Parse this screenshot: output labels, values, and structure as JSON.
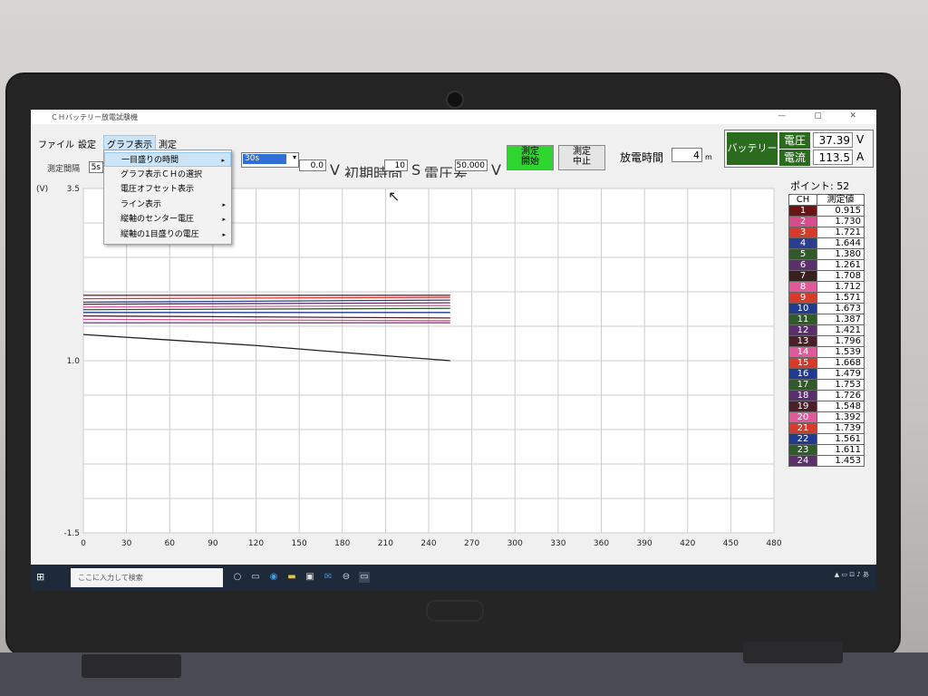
{
  "titlebar": {
    "title": "ＣＨバッテリー放電試験機",
    "controls": "— ▢ ✕"
  },
  "menu": {
    "file": "ファイル",
    "settings": "設定",
    "graph": "グラフ表示",
    "measure": "測定"
  },
  "dropdown": {
    "items": [
      {
        "label": "一目盛りの時間",
        "submenu": true
      },
      {
        "label": "グラフ表示ＣＨの選択",
        "submenu": false
      },
      {
        "label": "電圧オフセット表示",
        "submenu": false
      },
      {
        "label": "ライン表示",
        "submenu": true
      },
      {
        "label": "縦軸のセンター電圧",
        "submenu": true
      },
      {
        "label": "縦軸の1目盛りの電圧",
        "submenu": true
      }
    ],
    "arrow": "▸"
  },
  "combo": {
    "value": "30s",
    "arrow": "▾"
  },
  "toolbar": {
    "interval_label": "測定間隔",
    "interval_value": "5s",
    "voltage_value": "0.0",
    "voltage_unit": "V",
    "init_time_label": "初期時間",
    "init_time_value": "10",
    "init_time_unit": "S",
    "voltage_diff_label": "電圧差",
    "voltage_diff_value": "50.000",
    "voltage_diff_unit": "V",
    "start_button": "測定\n開始",
    "stop_button": "測定\n中止",
    "discharge_label": "放電時間",
    "discharge_value": "4",
    "discharge_unit": "m"
  },
  "battery": {
    "button": "バッテリー",
    "voltage_label": "電圧",
    "voltage_value": "37.39",
    "voltage_unit": "V",
    "current_label": "電流",
    "current_value": "113.5",
    "current_unit": "A"
  },
  "points": {
    "label": "ポイント: 52"
  },
  "table": {
    "headers": [
      "CH",
      "測定値"
    ],
    "rows": [
      {
        "ch": "1",
        "value": "0.915",
        "color": "#6b1414"
      },
      {
        "ch": "2",
        "value": "1.730",
        "color": "#d64d8c"
      },
      {
        "ch": "3",
        "value": "1.721",
        "color": "#d63a2a"
      },
      {
        "ch": "4",
        "value": "1.644",
        "color": "#2a3d8f"
      },
      {
        "ch": "5",
        "value": "1.380",
        "color": "#2f5a2a"
      },
      {
        "ch": "6",
        "value": "1.261",
        "color": "#5a2f6b"
      },
      {
        "ch": "7",
        "value": "1.708",
        "color": "#3a1f1f"
      },
      {
        "ch": "8",
        "value": "1.712",
        "color": "#e05a9a"
      },
      {
        "ch": "9",
        "value": "1.571",
        "color": "#d63a2a"
      },
      {
        "ch": "10",
        "value": "1.673",
        "color": "#1f3a8f"
      },
      {
        "ch": "11",
        "value": "1.387",
        "color": "#2f5a2a"
      },
      {
        "ch": "12",
        "value": "1.421",
        "color": "#5a2f6b"
      },
      {
        "ch": "13",
        "value": "1.796",
        "color": "#4a1f2a"
      },
      {
        "ch": "14",
        "value": "1.539",
        "color": "#e05a9a"
      },
      {
        "ch": "15",
        "value": "1.668",
        "color": "#d63a2a"
      },
      {
        "ch": "16",
        "value": "1.479",
        "color": "#1f3a8f"
      },
      {
        "ch": "17",
        "value": "1.753",
        "color": "#2f5a2a"
      },
      {
        "ch": "18",
        "value": "1.726",
        "color": "#5a2f6b"
      },
      {
        "ch": "19",
        "value": "1.548",
        "color": "#4a1f2a"
      },
      {
        "ch": "20",
        "value": "1.392",
        "color": "#e05a9a"
      },
      {
        "ch": "21",
        "value": "1.739",
        "color": "#d63a2a"
      },
      {
        "ch": "22",
        "value": "1.561",
        "color": "#1f3a8f"
      },
      {
        "ch": "23",
        "value": "1.611",
        "color": "#2f5a2a"
      },
      {
        "ch": "24",
        "value": "1.453",
        "color": "#5a2f6b"
      }
    ]
  },
  "chart_data": {
    "type": "line",
    "ylabel": "(V)",
    "y_ticks": [
      "3.5",
      "1.0",
      "-1.5"
    ],
    "ylim": [
      -1.5,
      3.5
    ],
    "x_ticks": [
      "0",
      "30",
      "60",
      "90",
      "120",
      "150",
      "180",
      "210",
      "240",
      "270",
      "300",
      "330",
      "360",
      "390",
      "420",
      "450",
      "480"
    ],
    "xlim": [
      0,
      480
    ],
    "x_tick_step": 30,
    "grid": true,
    "series": [
      {
        "values_x": [
          0,
          255
        ],
        "values_y": [
          1.95,
          1.95
        ],
        "color": "#8a1f3a"
      },
      {
        "values_x": [
          0,
          255
        ],
        "values_y": [
          1.9,
          1.92
        ],
        "color": "#d63a2a"
      },
      {
        "values_x": [
          0,
          255
        ],
        "values_y": [
          1.85,
          1.88
        ],
        "color": "#2a3d8f"
      },
      {
        "values_x": [
          0,
          255
        ],
        "values_y": [
          1.82,
          1.84
        ],
        "color": "#5a2f6b"
      },
      {
        "values_x": [
          0,
          255
        ],
        "values_y": [
          1.78,
          1.8
        ],
        "color": "#e05a9a"
      },
      {
        "values_x": [
          0,
          255
        ],
        "values_y": [
          1.74,
          1.76
        ],
        "color": "#2f5a2a"
      },
      {
        "values_x": [
          0,
          255
        ],
        "values_y": [
          1.7,
          1.7
        ],
        "color": "#1f3a8f"
      },
      {
        "values_x": [
          0,
          255
        ],
        "values_y": [
          1.65,
          1.62
        ],
        "color": "#4a1f2a"
      },
      {
        "values_x": [
          0,
          255
        ],
        "values_y": [
          1.6,
          1.58
        ],
        "color": "#d64d8c"
      },
      {
        "values_x": [
          0,
          255
        ],
        "values_y": [
          1.55,
          1.55
        ],
        "color": "#7a4a8a"
      },
      {
        "values_x": [
          0,
          60,
          120,
          180,
          255
        ],
        "values_y": [
          1.38,
          1.3,
          1.22,
          1.12,
          1.0
        ],
        "color": "#222222"
      }
    ]
  },
  "taskbar": {
    "search_placeholder": "ここに入力して検索",
    "tray": "▲ ▭ ⊡ ♪ あ"
  },
  "icons": {
    "windows": "⊞",
    "cursor": "↖"
  }
}
